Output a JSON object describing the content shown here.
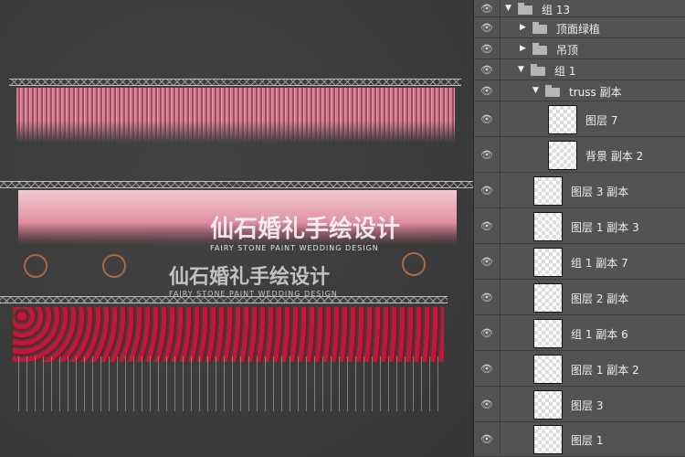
{
  "canvas": {
    "watermark_cn": "仙石婚礼手绘设计",
    "watermark_en": "FAIRY STONE PAINT WEDDING DESIGN"
  },
  "layers": [
    {
      "name": "组 13",
      "type": "group",
      "expanded": true,
      "indent": 0
    },
    {
      "name": "顶面绿植",
      "type": "group",
      "expanded": false,
      "indent": 1
    },
    {
      "name": "吊顶",
      "type": "group",
      "expanded": false,
      "indent": 1
    },
    {
      "name": "组 1",
      "type": "group",
      "expanded": true,
      "indent": 1
    },
    {
      "name": "truss 副本",
      "type": "group",
      "expanded": true,
      "indent": 2
    },
    {
      "name": "图层 7",
      "type": "layer",
      "indent": 3
    },
    {
      "name": "背景 副本 2",
      "type": "layer",
      "indent": 3
    },
    {
      "name": "图层 3 副本",
      "type": "layer",
      "indent": 2
    },
    {
      "name": "图层 1 副本 3",
      "type": "layer",
      "indent": 2
    },
    {
      "name": "组 1 副本 7",
      "type": "layer",
      "indent": 2
    },
    {
      "name": "图层 2 副本",
      "type": "layer",
      "indent": 2
    },
    {
      "name": "组 1 副本 6",
      "type": "layer",
      "indent": 2
    },
    {
      "name": "图层 1 副本 2",
      "type": "layer",
      "indent": 2
    },
    {
      "name": "图层 3",
      "type": "layer",
      "indent": 2
    },
    {
      "name": "图层 1",
      "type": "layer",
      "indent": 2
    }
  ],
  "icons": {
    "visibility": "eye-icon",
    "group": "folder-icon",
    "expand": "triangle-icon"
  }
}
